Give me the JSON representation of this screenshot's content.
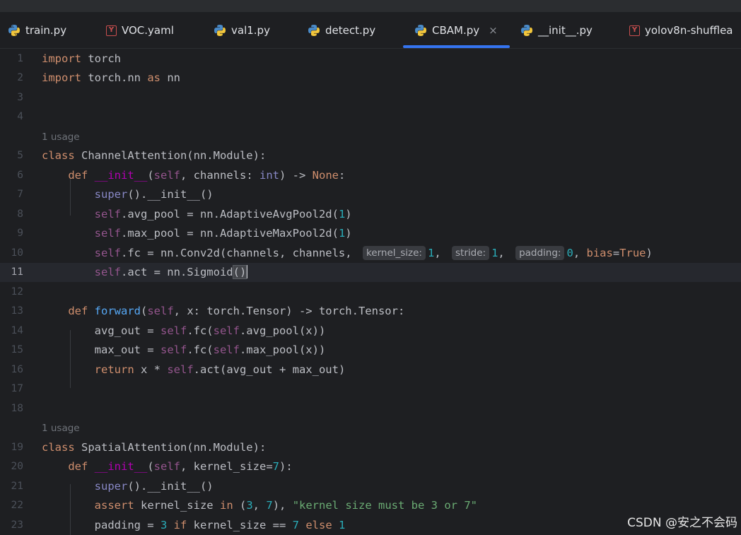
{
  "tabs": [
    {
      "label": "train.py",
      "icon": "python-icon",
      "active": false
    },
    {
      "label": "VOC.yaml",
      "icon": "yaml-icon",
      "active": false
    },
    {
      "label": "val1.py",
      "icon": "python-icon",
      "active": false
    },
    {
      "label": "detect.py",
      "icon": "python-icon",
      "active": false
    },
    {
      "label": "CBAM.py",
      "icon": "python-icon",
      "active": true,
      "close": "×"
    },
    {
      "label": "__init__.py",
      "icon": "python-icon",
      "active": false
    },
    {
      "label": "yolov8n-shufflea",
      "icon": "yaml-icon",
      "active": false
    }
  ],
  "usage_hints": [
    "1 usage",
    "1 usage"
  ],
  "line_numbers": [
    "1",
    "2",
    "3",
    "4",
    "5",
    "6",
    "7",
    "8",
    "9",
    "10",
    "11",
    "12",
    "13",
    "14",
    "15",
    "16",
    "17",
    "18",
    "19",
    "20",
    "21",
    "22",
    "23"
  ],
  "current_line": "11",
  "inlay_hints": {
    "kernel_size": "kernel_size:",
    "stride": "stride:",
    "padding": "padding:"
  },
  "code": {
    "l1": [
      "import",
      " torch"
    ],
    "l2": [
      "import",
      " torch.nn ",
      "as",
      " nn"
    ],
    "l5": [
      "class",
      " ChannelAttention(nn.Module):"
    ],
    "l6": [
      "def",
      " ",
      "__init__",
      "(",
      "self",
      ", channels: ",
      "int",
      ") -> ",
      "None",
      ":"
    ],
    "l7": [
      "super",
      "().__init__()"
    ],
    "l8": [
      "self",
      ".avg_pool = nn.AdaptiveAvgPool2d(",
      "1",
      ")"
    ],
    "l9": [
      "self",
      ".max_pool = nn.AdaptiveMaxPool2d(",
      "1",
      ")"
    ],
    "l10": [
      "self",
      ".fc = nn.Conv2d(channels, channels, ",
      "1",
      ", ",
      "1",
      ", ",
      "0",
      ", ",
      "bias",
      "=",
      "True",
      ")"
    ],
    "l11": [
      "self",
      ".act = nn.Sigmoid",
      "()"
    ],
    "l13": [
      "def",
      " ",
      "forward",
      "(",
      "self",
      ", x: torch.Tensor) -> torch.Tensor:"
    ],
    "l14": [
      "avg_out = ",
      "self",
      ".fc(",
      "self",
      ".avg_pool(x))"
    ],
    "l15": [
      "max_out = ",
      "self",
      ".fc(",
      "self",
      ".max_pool(x))"
    ],
    "l16": [
      "return",
      " x * ",
      "self",
      ".act(avg_out + max_out)"
    ],
    "l19": [
      "class",
      " SpatialAttention(nn.Module):"
    ],
    "l20": [
      "def",
      " ",
      "__init__",
      "(",
      "self",
      ", kernel_size=",
      "7",
      "):"
    ],
    "l21": [
      "super",
      "().__init__()"
    ],
    "l22": [
      "assert",
      " kernel_size ",
      "in",
      " (",
      "3",
      ", ",
      "7",
      "), ",
      "\"kernel size must be 3 or 7\""
    ],
    "l23": [
      "padding = ",
      "3",
      " ",
      "if",
      " kernel_size == ",
      "7",
      " ",
      "else",
      " ",
      "1"
    ]
  },
  "watermark": "CSDN @安之不会码",
  "colors": {
    "background": "#1e1f22",
    "keyword": "#cf8e6d",
    "self": "#94558d",
    "function": "#56a8f5",
    "number": "#2aacb8",
    "string": "#6aab73",
    "tab_underline": "#3574f0"
  }
}
